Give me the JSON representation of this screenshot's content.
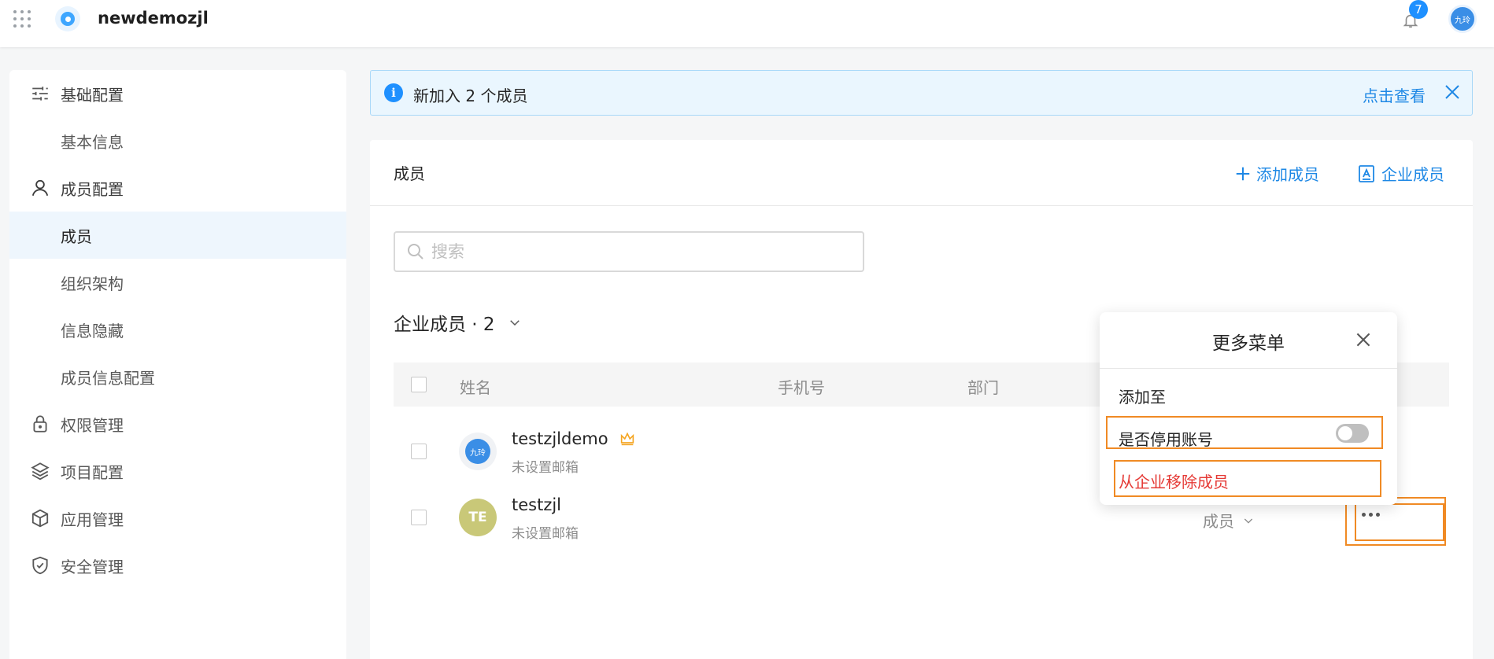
{
  "topbar": {
    "app_name": "newdemozjl",
    "notification_count": "7",
    "user_avatar_text": "九玲"
  },
  "sidebar": {
    "items": [
      {
        "label": "基础配置",
        "icon": "sliders-icon",
        "type": "group"
      },
      {
        "label": "基本信息",
        "type": "sub"
      },
      {
        "label": "成员配置",
        "icon": "user-icon",
        "type": "group"
      },
      {
        "label": "成员",
        "type": "sub",
        "active": true
      },
      {
        "label": "组织架构",
        "type": "sub"
      },
      {
        "label": "信息隐藏",
        "type": "sub"
      },
      {
        "label": "成员信息配置",
        "type": "sub"
      },
      {
        "label": "权限管理",
        "icon": "lock-icon",
        "type": "group"
      },
      {
        "label": "项目配置",
        "icon": "layers-icon",
        "type": "group"
      },
      {
        "label": "应用管理",
        "icon": "cube-icon",
        "type": "group"
      },
      {
        "label": "安全管理",
        "icon": "shield-icon",
        "type": "group"
      }
    ]
  },
  "banner": {
    "message": "新加入 2 个成员",
    "link_label": "点击查看"
  },
  "card": {
    "title": "成员",
    "add_member_label": "添加成员",
    "corp_member_label": "企业成员",
    "search_placeholder": "搜索",
    "members_heading": "企业成员 · 2",
    "table": {
      "columns": [
        "姓名",
        "手机号",
        "部门"
      ],
      "rows": [
        {
          "name": "testzjldemo",
          "email": "未设置邮箱",
          "avatar_text": "九玲",
          "avatar_color": "#3a8ee6",
          "is_owner": true
        },
        {
          "name": "testzjl",
          "email": "未设置邮箱",
          "avatar_text": "TE",
          "avatar_color": "#c9c878",
          "role": "成员"
        }
      ]
    }
  },
  "popup": {
    "title": "更多菜单",
    "section_label": "添加至",
    "disable_label": "是否停用账号",
    "disable_on": false,
    "remove_label": "从企业移除成员"
  },
  "colors": {
    "accent": "#1e88e5",
    "danger": "#e53935",
    "highlight": "#f08a24",
    "owner_crown": "#f5a623"
  }
}
